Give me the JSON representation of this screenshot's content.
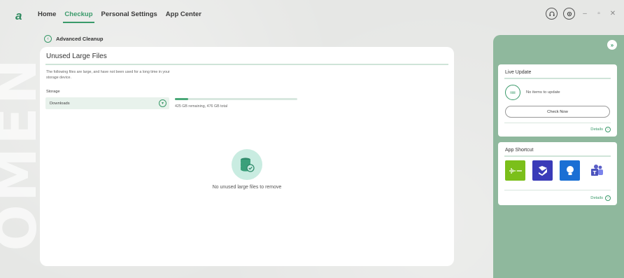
{
  "app": {
    "logo_text": "a",
    "nav": [
      {
        "label": "Home",
        "active": false
      },
      {
        "label": "Checkup",
        "active": true
      },
      {
        "label": "Personal Settings",
        "active": false
      },
      {
        "label": "App Center",
        "active": false
      }
    ],
    "watermark": "OMEN",
    "window_controls": {
      "minimize": "–",
      "restore": "▫",
      "close": "✕"
    }
  },
  "breadcrumb": {
    "label": "Advanced Cleanup"
  },
  "main": {
    "title": "Unused Large Files",
    "description": "The following files are large, and have not been used for a long time in your storage device.",
    "storage_label": "Storage",
    "storage_value": "Downloads",
    "storage_used_fraction": 0.107,
    "storage_text": "425 GB remaining, 476 GB total",
    "empty_message": "No unused large files to remove"
  },
  "right_panel": {
    "live_update": {
      "title": "Live Update",
      "message": "No items to update",
      "button": "Check Now",
      "details": "Details"
    },
    "app_shortcut": {
      "title": "App Shortcut",
      "apps": [
        {
          "name": "audio-app-icon",
          "color": "#7bbf1a"
        },
        {
          "name": "uxbridge-app-icon",
          "color": "#3a3bb8"
        },
        {
          "name": "tips-app-icon",
          "color": "#1a6fd4"
        },
        {
          "name": "teams-app-icon",
          "color": "#ffffff"
        }
      ],
      "details": "Details"
    }
  },
  "colors": {
    "accent": "#3a9a6a",
    "panel": "#8fb89d",
    "background": "#e6e7e5"
  }
}
